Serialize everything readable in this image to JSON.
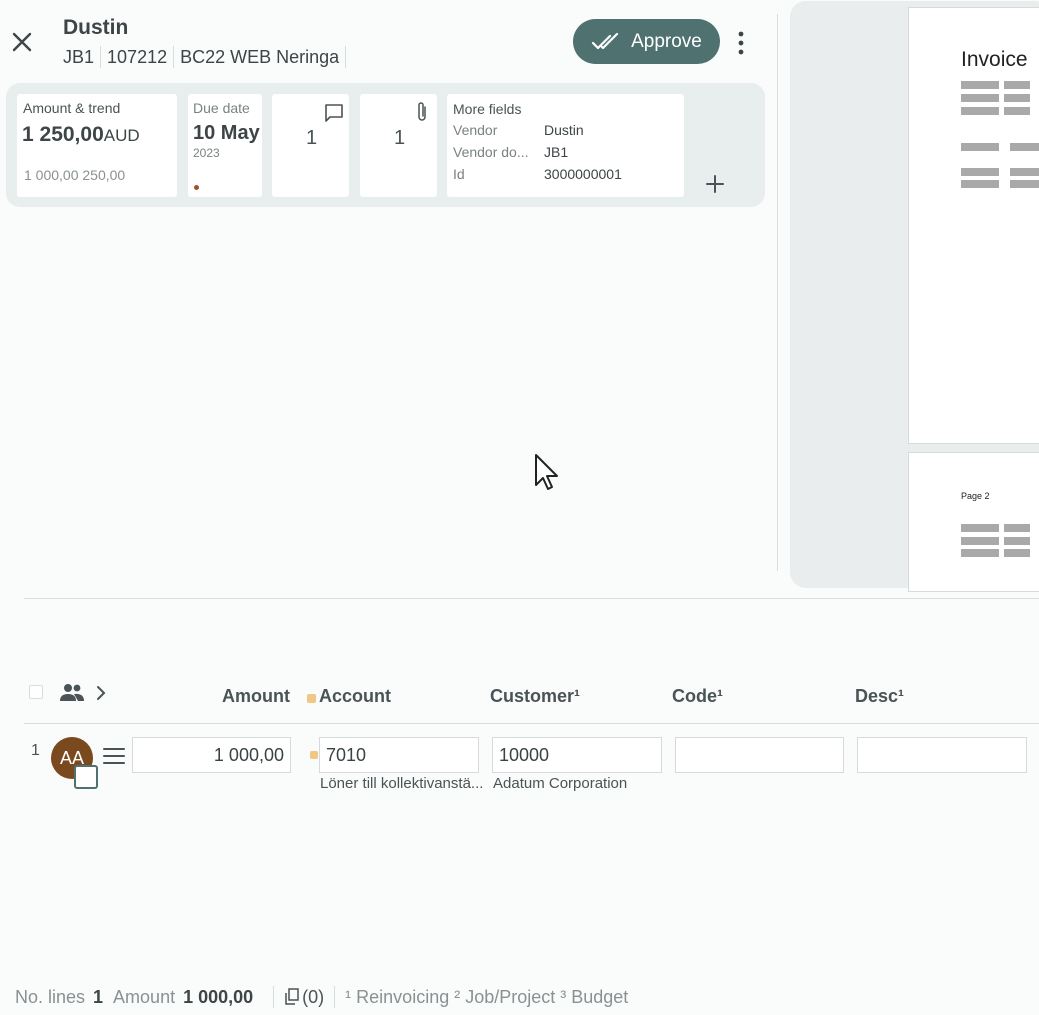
{
  "header": {
    "title": "Dustin",
    "sub1": "JB1",
    "sub2": "107212",
    "sub3": "BC22 WEB Neringa",
    "approve_label": "Approve"
  },
  "cards": {
    "amount": {
      "label": "Amount & trend",
      "value": "1 250,00",
      "currency": "AUD",
      "trend": "1 000,00 250,00"
    },
    "due": {
      "label": "Due date",
      "day": "10 May",
      "year": "2023"
    },
    "comments": {
      "count": "1"
    },
    "attachments": {
      "count": "1"
    },
    "more": {
      "label": "More fields",
      "rows": [
        {
          "k": "Vendor",
          "v": "Dustin"
        },
        {
          "k": "Vendor do...",
          "v": "JB1"
        },
        {
          "k": "Id",
          "v": "3000000001"
        }
      ]
    }
  },
  "preview": {
    "page1_title": "Invoice",
    "page2_title": "Page 2"
  },
  "table": {
    "headers": {
      "amount": "Amount",
      "account": "Account",
      "customer": "Customer¹",
      "code": "Code¹",
      "desc": "Desc¹"
    },
    "row": {
      "num": "1",
      "avatar": "AA",
      "amount": "1 000,00",
      "account": "7010",
      "account_desc": "Löner till kollektivanstä...",
      "customer": "10000",
      "customer_desc": "Adatum Corporation",
      "code": "",
      "desc": ""
    }
  },
  "footer": {
    "lines_label": "No. lines",
    "lines_value": "1",
    "amount_label": "Amount",
    "amount_value": "1 000,00",
    "copies": "(0)",
    "notes": "¹ Reinvoicing ² Job/Project ³ Budget"
  },
  "colors": {
    "accent": "#4f7271",
    "avatar": "#7a4a1e",
    "warn_dot": "#f0b44c",
    "due_dot": "#a0522d"
  }
}
